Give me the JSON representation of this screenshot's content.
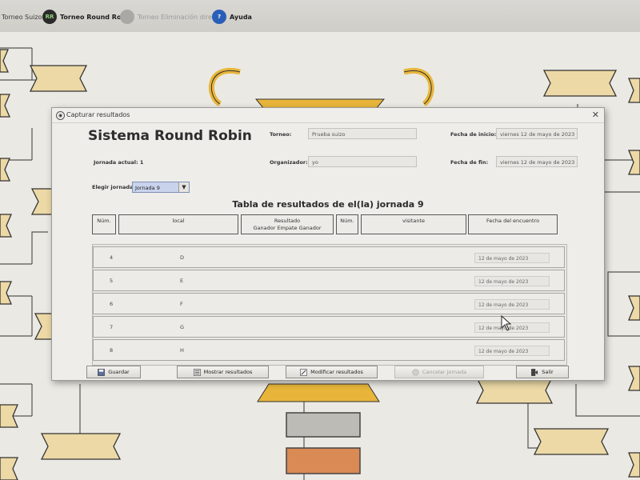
{
  "topbar": {
    "items": [
      {
        "label": "Torneo Suizo",
        "style": "normal"
      },
      {
        "label": "Torneo Round Robin",
        "style": "bold",
        "icon": "rr-badge-icon",
        "icon_text": "RR",
        "color": "#333333"
      },
      {
        "label": "Torneo Eliminación directa",
        "style": "muted",
        "icon": "grey-circle-icon",
        "color": "#9a9a9a"
      },
      {
        "label": "Ayuda",
        "style": "bold",
        "icon": "help-icon",
        "icon_text": "?",
        "color": "#2a5fb8"
      }
    ]
  },
  "dialog": {
    "window_title": "Capturar resultados",
    "system_title": "Sistema Round Robin",
    "torneo_label": "Torneo:",
    "torneo_value": "Prueba suizo",
    "inicio_label": "Fecha de inicio:",
    "inicio_value": "viernes 12 de mayo de 2023",
    "jornada_actual_label": "Jornada actual: 1",
    "organizador_label": "Organizador:",
    "organizador_value": "yo",
    "fin_label": "Fecha de fin:",
    "fin_value": "viernes 12 de mayo de 2023",
    "elegir_label": "Elegir jornada:",
    "jornada_selected": "Jornada 9",
    "table_title": "Tabla de resultados de el(la) jornada 9",
    "headers": {
      "num1": "Núm.",
      "local": "local",
      "resultado": "Resultado",
      "resultado_sub": "Ganador Empate Ganador",
      "num2": "Núm.",
      "visitante": "visitante",
      "fecha": "Fecha del encuentro"
    },
    "rows": [
      {
        "num": "4",
        "team": "D",
        "date": "12 de mayo de 2023"
      },
      {
        "num": "5",
        "team": "E",
        "date": "12 de mayo de 2023"
      },
      {
        "num": "6",
        "team": "F",
        "date": "12 de mayo de 2023"
      },
      {
        "num": "7",
        "team": "G",
        "date": "12 de mayo de 2023"
      },
      {
        "num": "8",
        "team": "H",
        "date": "12 de mayo de 2023"
      }
    ],
    "buttons": {
      "guardar": "Guardar",
      "mostrar": "Mostrar resultados",
      "modificar": "Modificar resultados",
      "cancelar": "Cancelar jornada",
      "salir": "Salir"
    }
  },
  "colors": {
    "bracket_fill": "#ecd9a6",
    "bracket_stroke": "#4a4a4a",
    "trophy_gold": "#e8b53a",
    "bar_grey": "#bdbbb6",
    "bar_orange": "#d98a55"
  }
}
